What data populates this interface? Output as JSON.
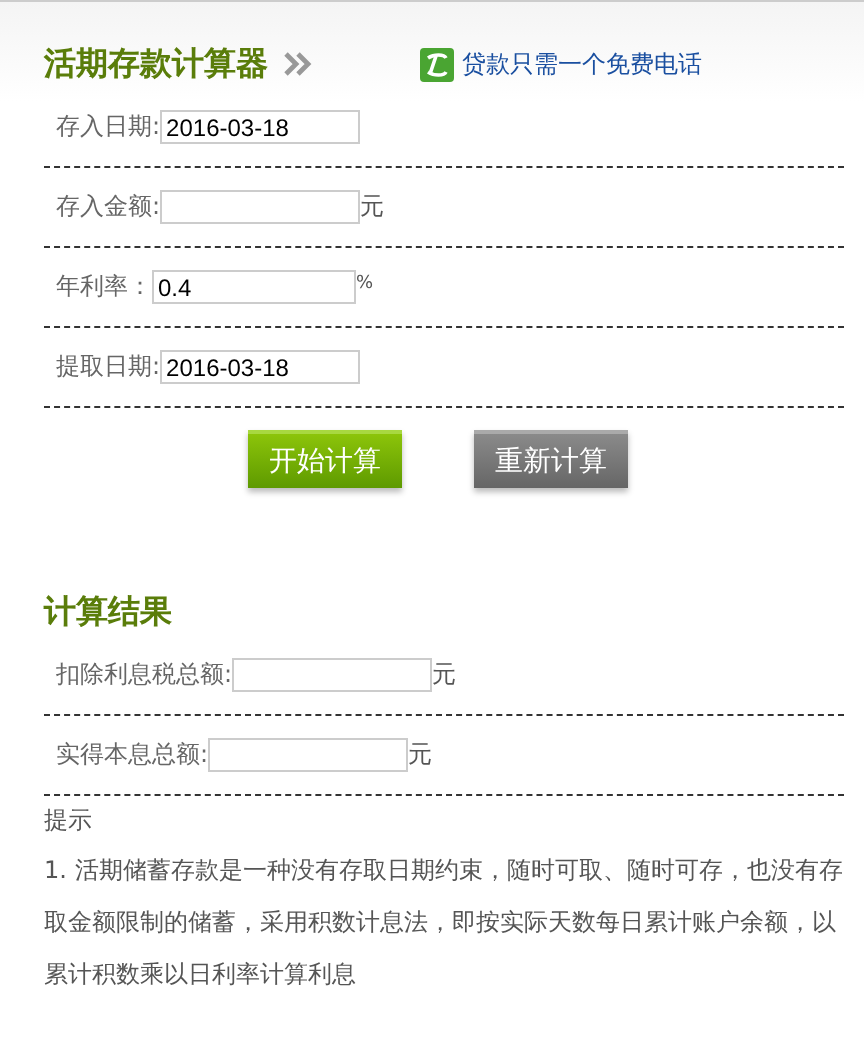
{
  "header": {
    "title": "活期存款计算器",
    "link": "贷款只需一个免费电话"
  },
  "form": [
    {
      "label": "存入日期:",
      "value": "2016-03-18"
    },
    {
      "label": "存入金额:",
      "unit": "元"
    },
    {
      "label": "年利率：",
      "value": "0.4",
      "unit": "%"
    },
    {
      "label": "提取日期:",
      "value": "2016-03-18"
    }
  ],
  "buttons": [
    {
      "label": "开始计算",
      "kind": "primary"
    },
    {
      "label": "重新计算",
      "kind": "secondary"
    }
  ],
  "results": {
    "title": "计算结果",
    "fields": [
      {
        "label": "扣除利息税总额:",
        "unit": "元"
      },
      {
        "label": "实得本息总额:",
        "unit": "元"
      }
    ]
  },
  "tips": {
    "title": "提示",
    "text": "1. 活期储蓄存款是一种没有存取日期约束，随时可取、随时可存，也没有存取金额限制的储蓄，采用积数计息法，即按实际天数每日累计账户余额，以累计积数乘以日利率计算利息"
  }
}
